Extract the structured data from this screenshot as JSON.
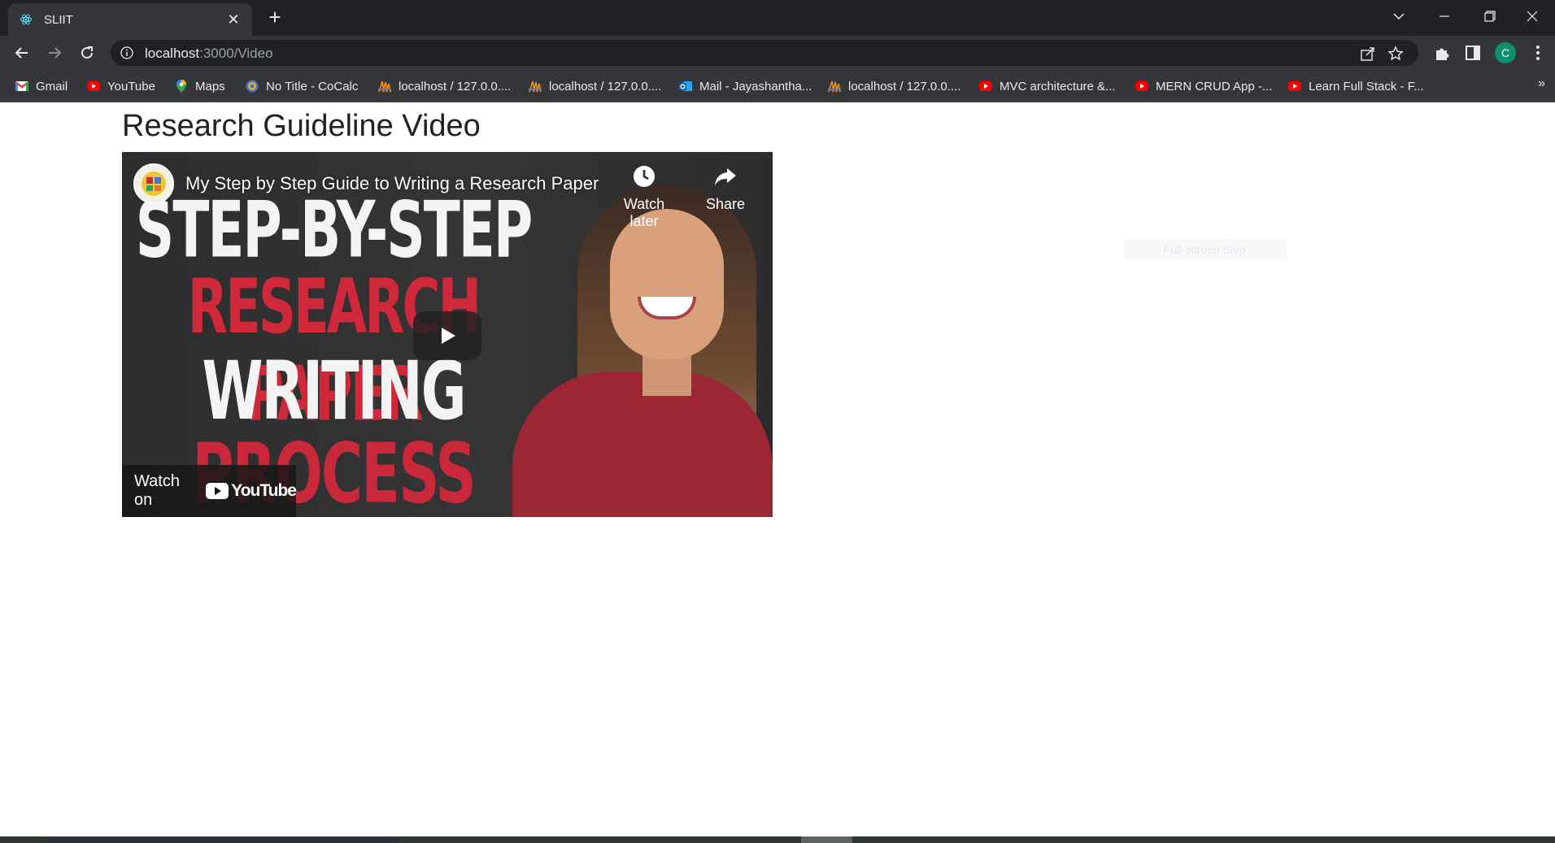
{
  "browser": {
    "tab_title": "SLIIT",
    "url_host": "localhost",
    "url_path": ":3000/Video",
    "profile_initial": "C",
    "bookmarks": [
      {
        "label": "Gmail",
        "icon": "gmail-icon"
      },
      {
        "label": "YouTube",
        "icon": "youtube-icon"
      },
      {
        "label": "Maps",
        "icon": "maps-icon"
      },
      {
        "label": "No Title - CoCalc",
        "icon": "cocalc-icon"
      },
      {
        "label": "localhost / 127.0.0....",
        "icon": "phpmyadmin-icon"
      },
      {
        "label": "localhost / 127.0.0....",
        "icon": "phpmyadmin-icon"
      },
      {
        "label": "Mail - Jayashantha...",
        "icon": "outlook-icon"
      },
      {
        "label": "localhost / 127.0.0....",
        "icon": "phpmyadmin-icon"
      },
      {
        "label": "MVC architecture &...",
        "icon": "youtube-icon"
      },
      {
        "label": "MERN CRUD App -...",
        "icon": "youtube-icon"
      },
      {
        "label": "Learn Full Stack - F...",
        "icon": "youtube-icon"
      }
    ],
    "bookmarks_more": "»"
  },
  "page": {
    "heading": "Research Guideline Video"
  },
  "video": {
    "title": "My Step by Step Guide to Writing a Research Paper",
    "watch_later": "Watch later",
    "share": "Share",
    "watch_on": "Watch on",
    "youtube_logo": "YouTube",
    "thumbnail_lines": [
      "STEP-BY-STEP",
      "RESEARCH PAPER",
      "WRITING",
      "PROCESS"
    ]
  },
  "overlay": {
    "snip_label": "Full-screen Snip"
  },
  "colors": {
    "chrome_dark": "#202124",
    "chrome_toolbar": "#35363a",
    "youtube_red": "#ff0000",
    "thumbnail_red": "#d0283b",
    "avatar": "#0d8f6d"
  }
}
